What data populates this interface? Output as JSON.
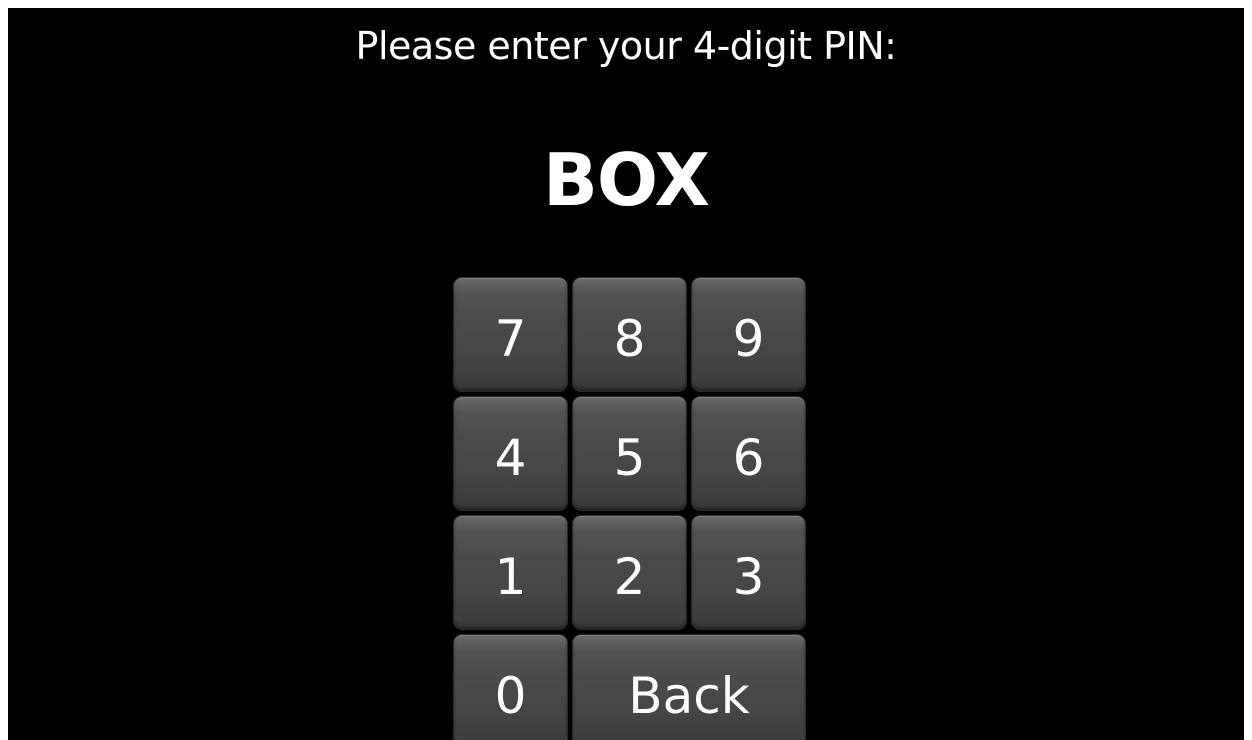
{
  "prompt": "Please enter your 4-digit PIN:",
  "entry_display": "BOX",
  "keypad": {
    "rows": [
      [
        "7",
        "8",
        "9"
      ],
      [
        "4",
        "5",
        "6"
      ],
      [
        "1",
        "2",
        "3"
      ]
    ],
    "zero": "0",
    "back": "Back"
  },
  "colors": {
    "background": "#000000",
    "text": "#ffffff",
    "key_face": "#4a4a4a"
  }
}
